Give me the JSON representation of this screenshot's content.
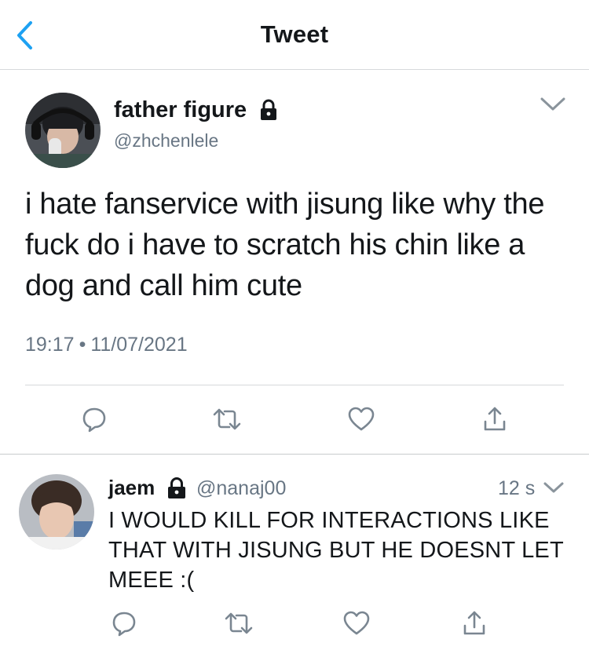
{
  "nav": {
    "title": "Tweet",
    "back_icon": "chevron-left-icon",
    "accent_color": "#1da1f2"
  },
  "tweet": {
    "author_name": "father figure",
    "author_handle": "@zhchenlele",
    "protected_icon": "lock-icon",
    "text": "i hate fanservice with jisung like why the fuck do i have to scratch his chin like a dog and call him cute",
    "time": "19:17",
    "separator": "•",
    "date": "11/07/2021",
    "actions": [
      "reply-icon",
      "retweet-icon",
      "like-icon",
      "share-icon"
    ]
  },
  "reply": {
    "author_name": "jaem",
    "author_handle": "@nanaj00",
    "protected_icon": "lock-icon",
    "time": "12 s",
    "text": "I WOULD KILL FOR INTERACTIONS LIKE THAT WITH JISUNG BUT HE DOESNT LET MEEE :(",
    "actions": [
      "reply-icon",
      "retweet-icon",
      "like-icon",
      "share-icon"
    ]
  },
  "colors": {
    "text": "#14171a",
    "secondary": "#687684",
    "icon_gray": "#7a8691",
    "divider": "#d6d9db"
  }
}
